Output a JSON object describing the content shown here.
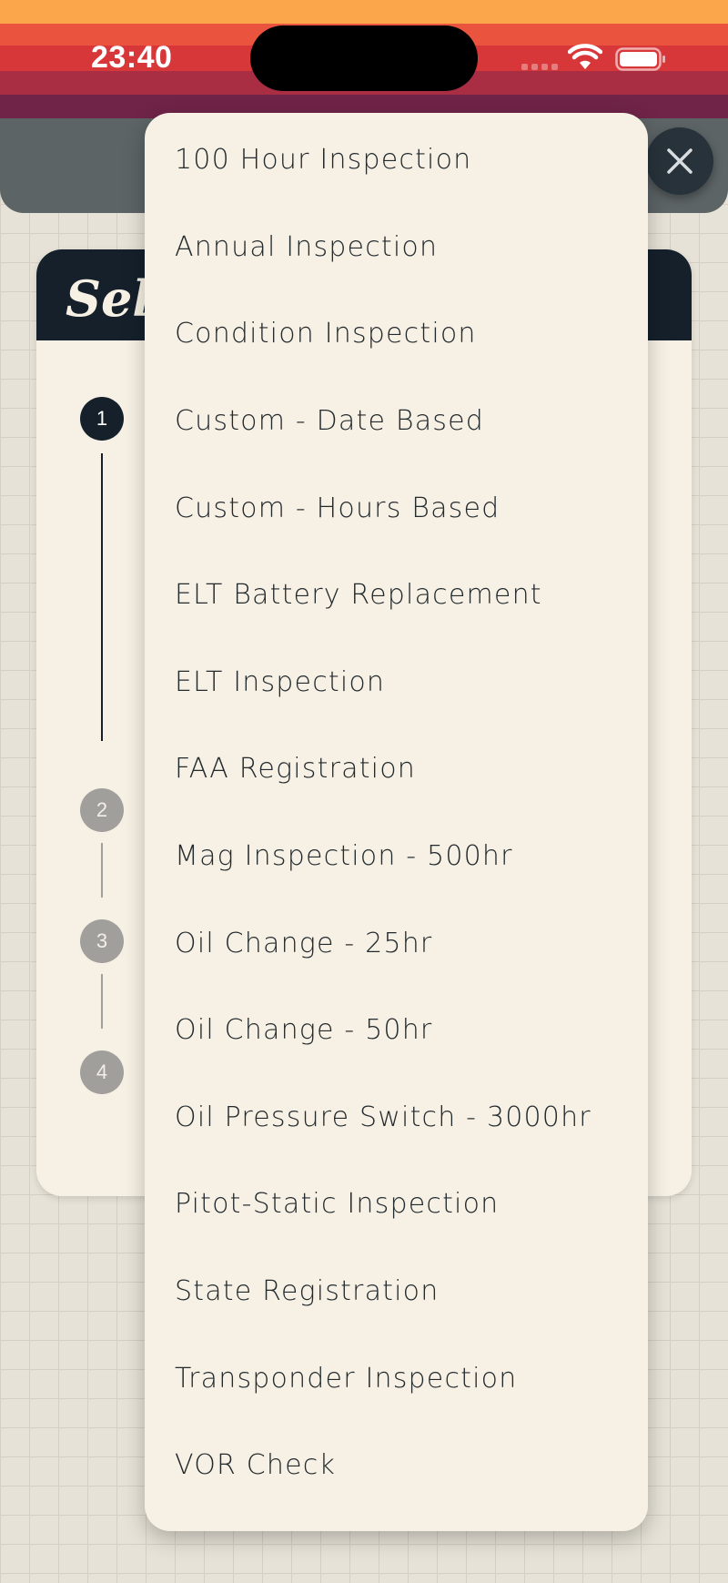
{
  "status_bar": {
    "time": "23:40",
    "icons": [
      "cellular-signal-icon",
      "wifi-icon",
      "battery-icon"
    ]
  },
  "header": {
    "close_icon": "close-icon"
  },
  "card": {
    "title_partial": "Sel",
    "steps": [
      "1",
      "2",
      "3",
      "4"
    ],
    "active_step": 1
  },
  "dropdown": {
    "options": [
      "100 Hour Inspection",
      "Annual Inspection",
      "Condition Inspection",
      "Custom - Date Based",
      "Custom - Hours Based",
      "ELT Battery Replacement",
      "ELT Inspection",
      "FAA Registration",
      "Mag Inspection - 500hr",
      "Oil Change - 25hr",
      "Oil Change - 50hr",
      "Oil Pressure Switch - 3000hr",
      "Pitot-Static Inspection",
      "State Registration",
      "Transponder Inspection",
      "VOR Check"
    ]
  },
  "colors": {
    "stripe_1": "#fba64a",
    "stripe_2": "#ea533d",
    "stripe_3": "#d8373a",
    "stripe_4": "#a92e44",
    "stripe_5": "#6f2448",
    "navy": "#15202b",
    "cream": "#f7f1e5",
    "header_gray": "#5d6466"
  }
}
